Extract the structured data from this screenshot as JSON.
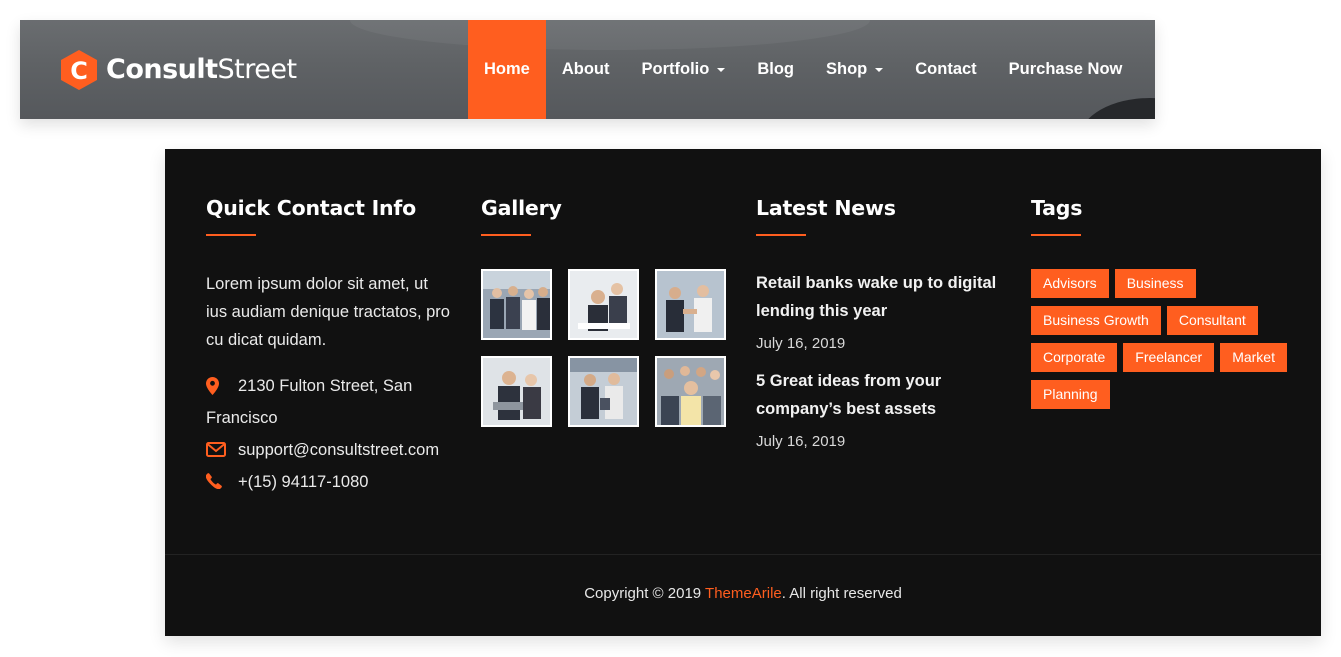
{
  "brand": {
    "logo_letter": "C",
    "name_bold": "Consult",
    "name_light": "Street",
    "accent_color": "#ff5e1f"
  },
  "nav": {
    "items": [
      {
        "label": "Home",
        "active": true
      },
      {
        "label": "About"
      },
      {
        "label": "Portfolio",
        "dropdown": true
      },
      {
        "label": "Blog"
      },
      {
        "label": "Shop",
        "dropdown": true
      },
      {
        "label": "Contact"
      },
      {
        "label": "Purchase Now"
      }
    ]
  },
  "footer": {
    "contact": {
      "title": "Quick Contact Info",
      "text": "Lorem ipsum dolor sit amet, ut ius audiam denique tractatos, pro cu dicat quidam.",
      "address": "2130 Fulton Street, San Francisco",
      "email": "support@consultstreet.com",
      "phone": "+(15) 94117-1080",
      "icons": [
        "map-marker-icon",
        "envelope-icon",
        "phone-icon"
      ]
    },
    "gallery": {
      "title": "Gallery"
    },
    "news": {
      "title": "Latest News",
      "items": [
        {
          "title": "Retail banks wake up to digital lending this year",
          "date": "July 16, 2019"
        },
        {
          "title": "5 Great ideas from your company’s best assets",
          "date": "July 16, 2019"
        }
      ]
    },
    "tags": {
      "title": "Tags",
      "items": [
        "Advisors",
        "Business",
        "Business Growth",
        "Consultant",
        "Corporate",
        "Freelancer",
        "Market",
        "Planning"
      ]
    },
    "copyright": {
      "prefix": "Copyright © 2019 ",
      "link": "ThemeArile",
      "suffix": ". All right reserved"
    }
  }
}
